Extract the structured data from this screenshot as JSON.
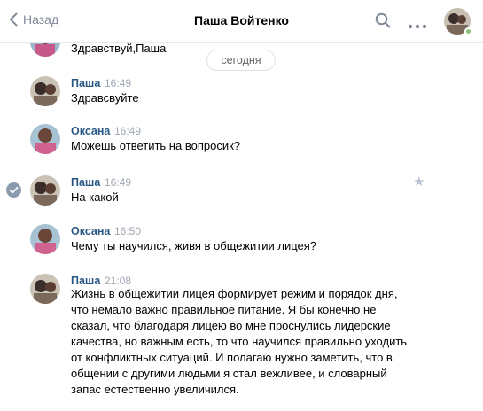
{
  "header": {
    "back_label": "Назад",
    "title": "Паша Войтенко",
    "search_icon": "search-icon",
    "more_icon": "more-horizontal-icon"
  },
  "date_separator": "сегодня",
  "messages": [
    {
      "author": "",
      "time": "",
      "text": "Здравствуй,Паша"
    },
    {
      "author": "Паша",
      "time": "16:49",
      "text": "Здравсвуйте"
    },
    {
      "author": "Оксана",
      "time": "16:49",
      "text": "Можешь ответить на вопросик?"
    },
    {
      "author": "Паша",
      "time": "16:49",
      "text": "На какой"
    },
    {
      "author": "Оксана",
      "time": "16:50",
      "text": "Чему ты научился, живя в общежитии лицея?"
    },
    {
      "author": "Паша",
      "time": "21:08",
      "lines": [
        "Жизнь в общежитии лицея формирует режим и порядок дня,",
        "что немало важно правильное питание. Я бы конечно не",
        "сказал, что благодаря лицею во мне проснулись лидерские",
        "качества, но важным есть, то что научился правильно уходить",
        "от конфликтных ситуаций. И полагаю нужно заметить, что в",
        "общении с другими людьми я стал вежливее, и словарный",
        "запас естественно увеличился."
      ]
    }
  ],
  "colors": {
    "author": "#2a5885",
    "time": "#a0a7b2",
    "online": "#8ac176"
  }
}
